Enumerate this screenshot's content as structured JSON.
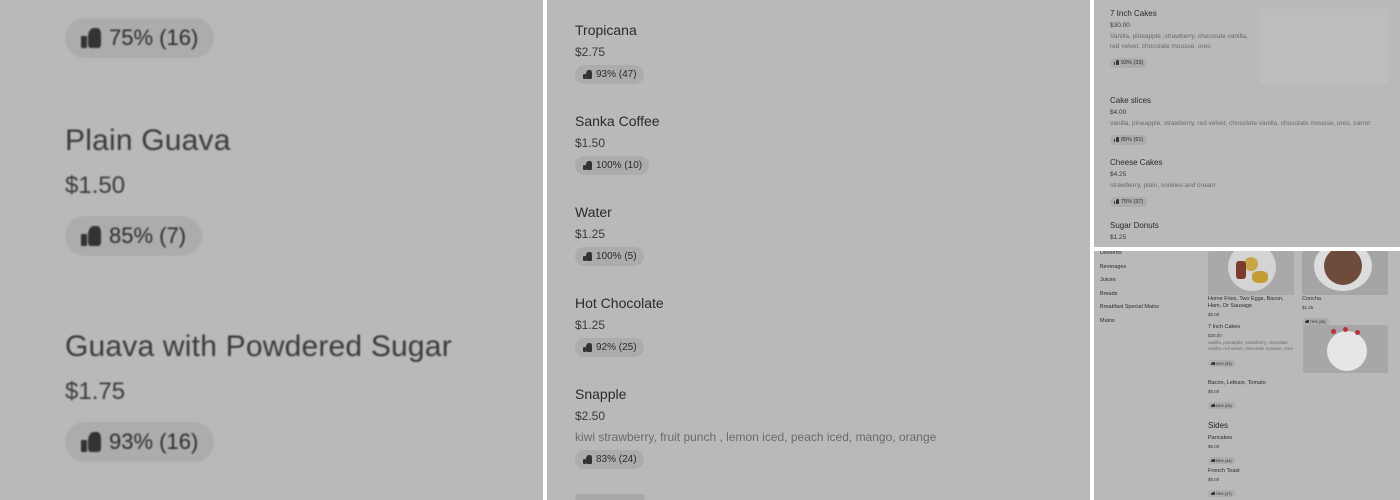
{
  "panel1": {
    "items": [
      {
        "name": "",
        "price": "",
        "rating": "75% (16)"
      },
      {
        "name": "Plain Guava",
        "price": "$1.50",
        "rating": "85% (7)"
      },
      {
        "name": "Guava with Powdered Sugar",
        "price": "$1.75",
        "rating": "93% (16)"
      }
    ]
  },
  "panel2": {
    "items": [
      {
        "name": "Tropicana",
        "price": "$2.75",
        "rating": "93% (47)"
      },
      {
        "name": "Sanka Coffee",
        "price": "$1.50",
        "rating": "100% (10)"
      },
      {
        "name": "Water",
        "price": "$1.25",
        "rating": "100% (5)"
      },
      {
        "name": "Hot Chocolate",
        "price": "$1.25",
        "rating": "92% (25)"
      },
      {
        "name": "Snapple",
        "price": "$2.50",
        "description": "kiwi strawberry, fruit punch , lemon iced, peach iced, mango, orange",
        "rating": "83% (24)"
      }
    ]
  },
  "panel3": {
    "items": [
      {
        "name": "7 Inch Cakes",
        "price": "$30.00",
        "description": "Vanilla, pineapple ,strawberry, chocolate vanilla, red velvet, chocolate mousse, oreo",
        "rating": "93% (33)"
      },
      {
        "name": "Cake slices",
        "price": "$4.00",
        "description": "vanilla, pineapple, strawberry, red velvet, chocolate vanilla, chocolate mousse, oreo, carrot",
        "rating": "85% (61)"
      },
      {
        "name": "Cheese Cakes",
        "price": "$4.25",
        "description": "strawberry, plain, cookies and cream",
        "rating": "75% (37)"
      },
      {
        "name": "Sugar Donuts",
        "price": "$1.25"
      }
    ]
  },
  "panel4": {
    "sidebar": [
      "Desserts",
      "Beverages",
      "Juices",
      "Breads",
      "Breakfast Special Mains",
      "Mains"
    ],
    "items": [
      {
        "name": "Home Fries, Two Eggs, Bacon, Ham, Or Sausage",
        "price": "$5.00"
      },
      {
        "name": "Concha",
        "price": "$1.25",
        "rating": "79% (38)"
      },
      {
        "name": "7 Inch Cakes",
        "price": "$30.00",
        "description": "vanilla, pineapple ,strawberry, chocolate vanilla, red velvet, chocolate mousse, oreo",
        "rating": "93% (33)"
      },
      {
        "name": "Bacon, Lettuce, Tomato",
        "price": "$5.00",
        "rating": "64% (25)"
      },
      {
        "name": "Pancakes",
        "price": "$5.00",
        "rating": "88% (44)"
      },
      {
        "name": "French Toast",
        "price": "$5.00",
        "rating": "78% (47)"
      }
    ],
    "section_title": "Sides"
  }
}
